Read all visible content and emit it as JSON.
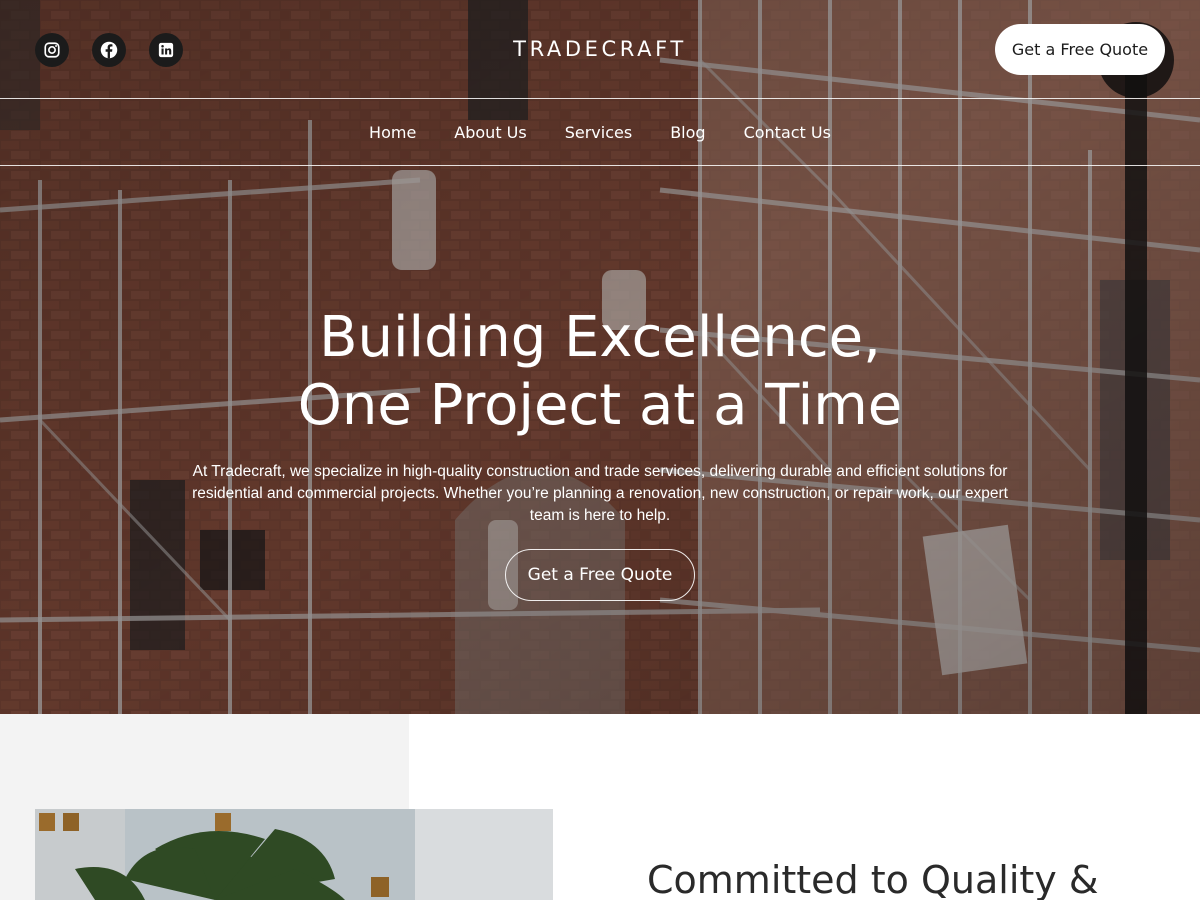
{
  "site": {
    "logo": "TRADECRAFT",
    "socials": [
      {
        "name": "instagram-icon"
      },
      {
        "name": "facebook-icon"
      },
      {
        "name": "linkedin-icon"
      }
    ],
    "header_cta": "Get a Free Quote"
  },
  "nav": {
    "items": [
      {
        "label": "Home"
      },
      {
        "label": "About Us"
      },
      {
        "label": "Services"
      },
      {
        "label": "Blog"
      },
      {
        "label": "Contact Us"
      }
    ]
  },
  "hero": {
    "title_line1": "Building Excellence,",
    "title_line2": "One Project at a Time",
    "description": "At Tradecraft, we specialize in high-quality construction and trade services, delivering durable and efficient solutions for residential and commercial projects. Whether you’re planning a renovation, new construction, or repair work, our expert team is here to help.",
    "cta": "Get a Free Quote"
  },
  "about": {
    "heading": "Committed to Quality &"
  },
  "colors": {
    "accent_button_bg": "#ffffff",
    "social_icon_bg": "#1b1b1b",
    "section_grey": "#f3f3f3"
  }
}
